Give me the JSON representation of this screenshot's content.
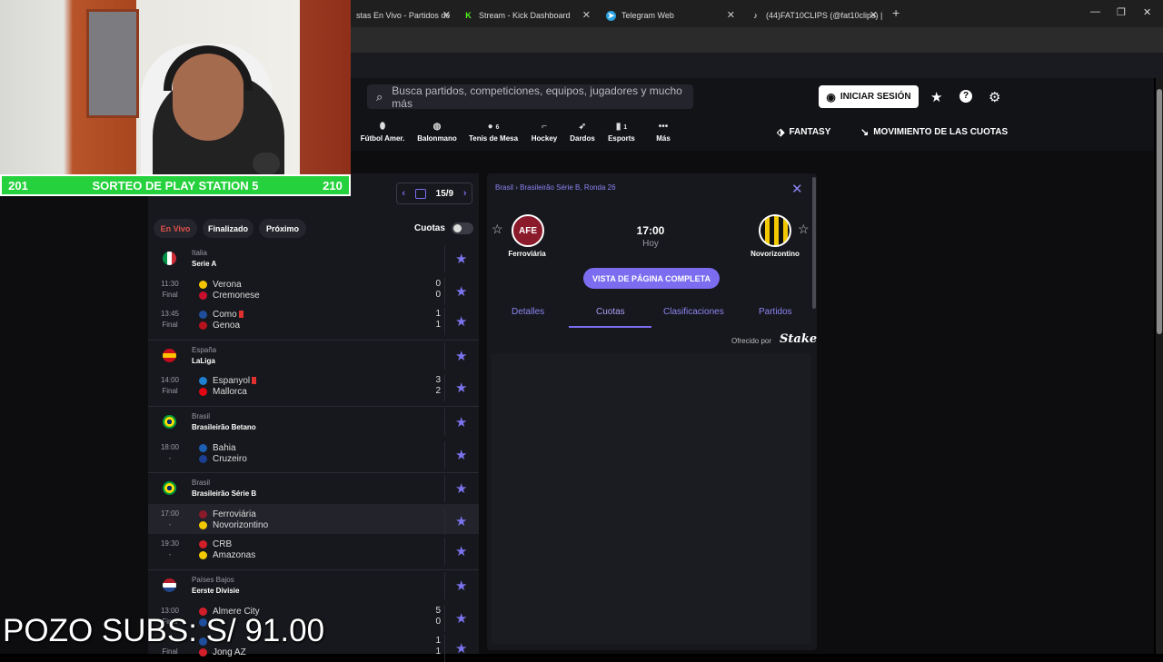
{
  "browser": {
    "tabs": [
      {
        "title": "stas En Vivo - Partidos de",
        "icon": "livescore-icon",
        "color": "#444"
      },
      {
        "title": "Stream - Kick Dashboard",
        "icon": "kick-icon",
        "color": "#53fc18"
      },
      {
        "title": "Telegram Web",
        "icon": "telegram-icon",
        "color": "#2aa1de"
      },
      {
        "title": "(44)FAT10CLIPS (@fat10clips) |",
        "icon": "tiktok-icon",
        "color": "#111"
      }
    ]
  },
  "header": {
    "search_placeholder": "Busca partidos, competiciones, equipos, jugadores y mucho más",
    "login_label": "INICIAR SESIÓN",
    "sports": [
      {
        "label": "Fútbol Amer.",
        "count": ""
      },
      {
        "label": "Balonmano",
        "count": ""
      },
      {
        "label": "Tenis de Mesa",
        "count": "6"
      },
      {
        "label": "Hockey",
        "count": ""
      },
      {
        "label": "Dardos",
        "count": ""
      },
      {
        "label": "Esports",
        "count": "1"
      },
      {
        "label": "Más",
        "count": ""
      }
    ],
    "fantasy": "FANTASY",
    "odds_movement": "MOVIMIENTO DE LAS CUOTAS"
  },
  "scores": {
    "date": "15/9",
    "filters": [
      "En Vivo",
      "Finalizado",
      "Próximo"
    ],
    "cuotas_label": "Cuotas",
    "leagues": [
      {
        "country": "Italia",
        "name": "Serie A",
        "flag_colors": [
          "#009246",
          "#ffffff",
          "#ce2b37"
        ],
        "matches": [
          {
            "time": "11:30",
            "status": "Final",
            "home": "Verona",
            "away": "Cremonese",
            "hs": "0",
            "as": "0",
            "home_color": "#f5c400",
            "away_color": "#c8102e",
            "home_red": false
          },
          {
            "time": "13:45",
            "status": "Final",
            "home": "Como",
            "away": "Genoa",
            "hs": "1",
            "as": "1",
            "home_color": "#1f4e9c",
            "away_color": "#b5121b",
            "home_red": true
          }
        ]
      },
      {
        "country": "España",
        "name": "LaLiga",
        "flag_colors": [
          "#c60b1e",
          "#ffc400",
          "#c60b1e"
        ],
        "matches": [
          {
            "time": "14:00",
            "status": "Final",
            "home": "Espanyol",
            "away": "Mallorca",
            "hs": "3",
            "as": "2",
            "home_color": "#1f7fd1",
            "away_color": "#e20613",
            "home_red": true
          }
        ]
      },
      {
        "country": "Brasil",
        "name": "Brasileirão Betano",
        "flag_colors": [
          "#009c3b",
          "#ffdf00",
          "#002776"
        ],
        "matches": [
          {
            "time": "18:00",
            "status": "-",
            "home": "Bahia",
            "away": "Cruzeiro",
            "hs": "",
            "as": "",
            "home_color": "#1c5fb3",
            "away_color": "#1c3f94",
            "home_red": false
          }
        ]
      },
      {
        "country": "Brasil",
        "name": "Brasileirão Série B",
        "flag_colors": [
          "#009c3b",
          "#ffdf00",
          "#002776"
        ],
        "matches": [
          {
            "time": "17:00",
            "status": "-",
            "home": "Ferroviária",
            "away": "Novorizontino",
            "hs": "",
            "as": "",
            "home_color": "#8b1a2b",
            "away_color": "#f2c800",
            "home_red": false
          },
          {
            "time": "19:30",
            "status": "-",
            "home": "CRB",
            "away": "Amazonas",
            "hs": "",
            "as": "",
            "home_color": "#d11f2a",
            "away_color": "#f2c800",
            "home_red": false
          }
        ]
      },
      {
        "country": "Países Bajos",
        "name": "Eerste Divisie",
        "flag_colors": [
          "#ae1c28",
          "#ffffff",
          "#21468b"
        ],
        "matches": [
          {
            "time": "13:00",
            "status": "Final",
            "home": "Almere City",
            "away": "",
            "hs": "5",
            "as": "0",
            "home_color": "#d11f2a",
            "away_color": "#1f4e9c",
            "home_red": false
          },
          {
            "time": "",
            "status": "Final",
            "home": "",
            "away": "Jong AZ",
            "hs": "1",
            "as": "1",
            "home_color": "#1f4e9c",
            "away_color": "#d11f2a",
            "home_red": false
          }
        ]
      }
    ]
  },
  "detail": {
    "breadcrumb_country": "Brasil",
    "breadcrumb_league": "Brasileirão Série B, Ronda 26",
    "home_team": "Ferroviária",
    "home_logo_text": "AFE",
    "away_team": "Novorizontino",
    "kickoff": "17:00",
    "day": "Hoy",
    "full_page_label": "VISTA DE PÁGINA COMPLETA",
    "tabs": [
      "Detalles",
      "Cuotas",
      "Clasificaciones",
      "Partidos"
    ],
    "offered_by": "Ofrecido por",
    "sponsor": "Stake"
  },
  "overlay": {
    "left_count": "201",
    "banner_text": "SORTEO DE PLAY STATION 5",
    "right_count": "210",
    "pozo_text": "POZO SUBS: S/ 91.00"
  }
}
